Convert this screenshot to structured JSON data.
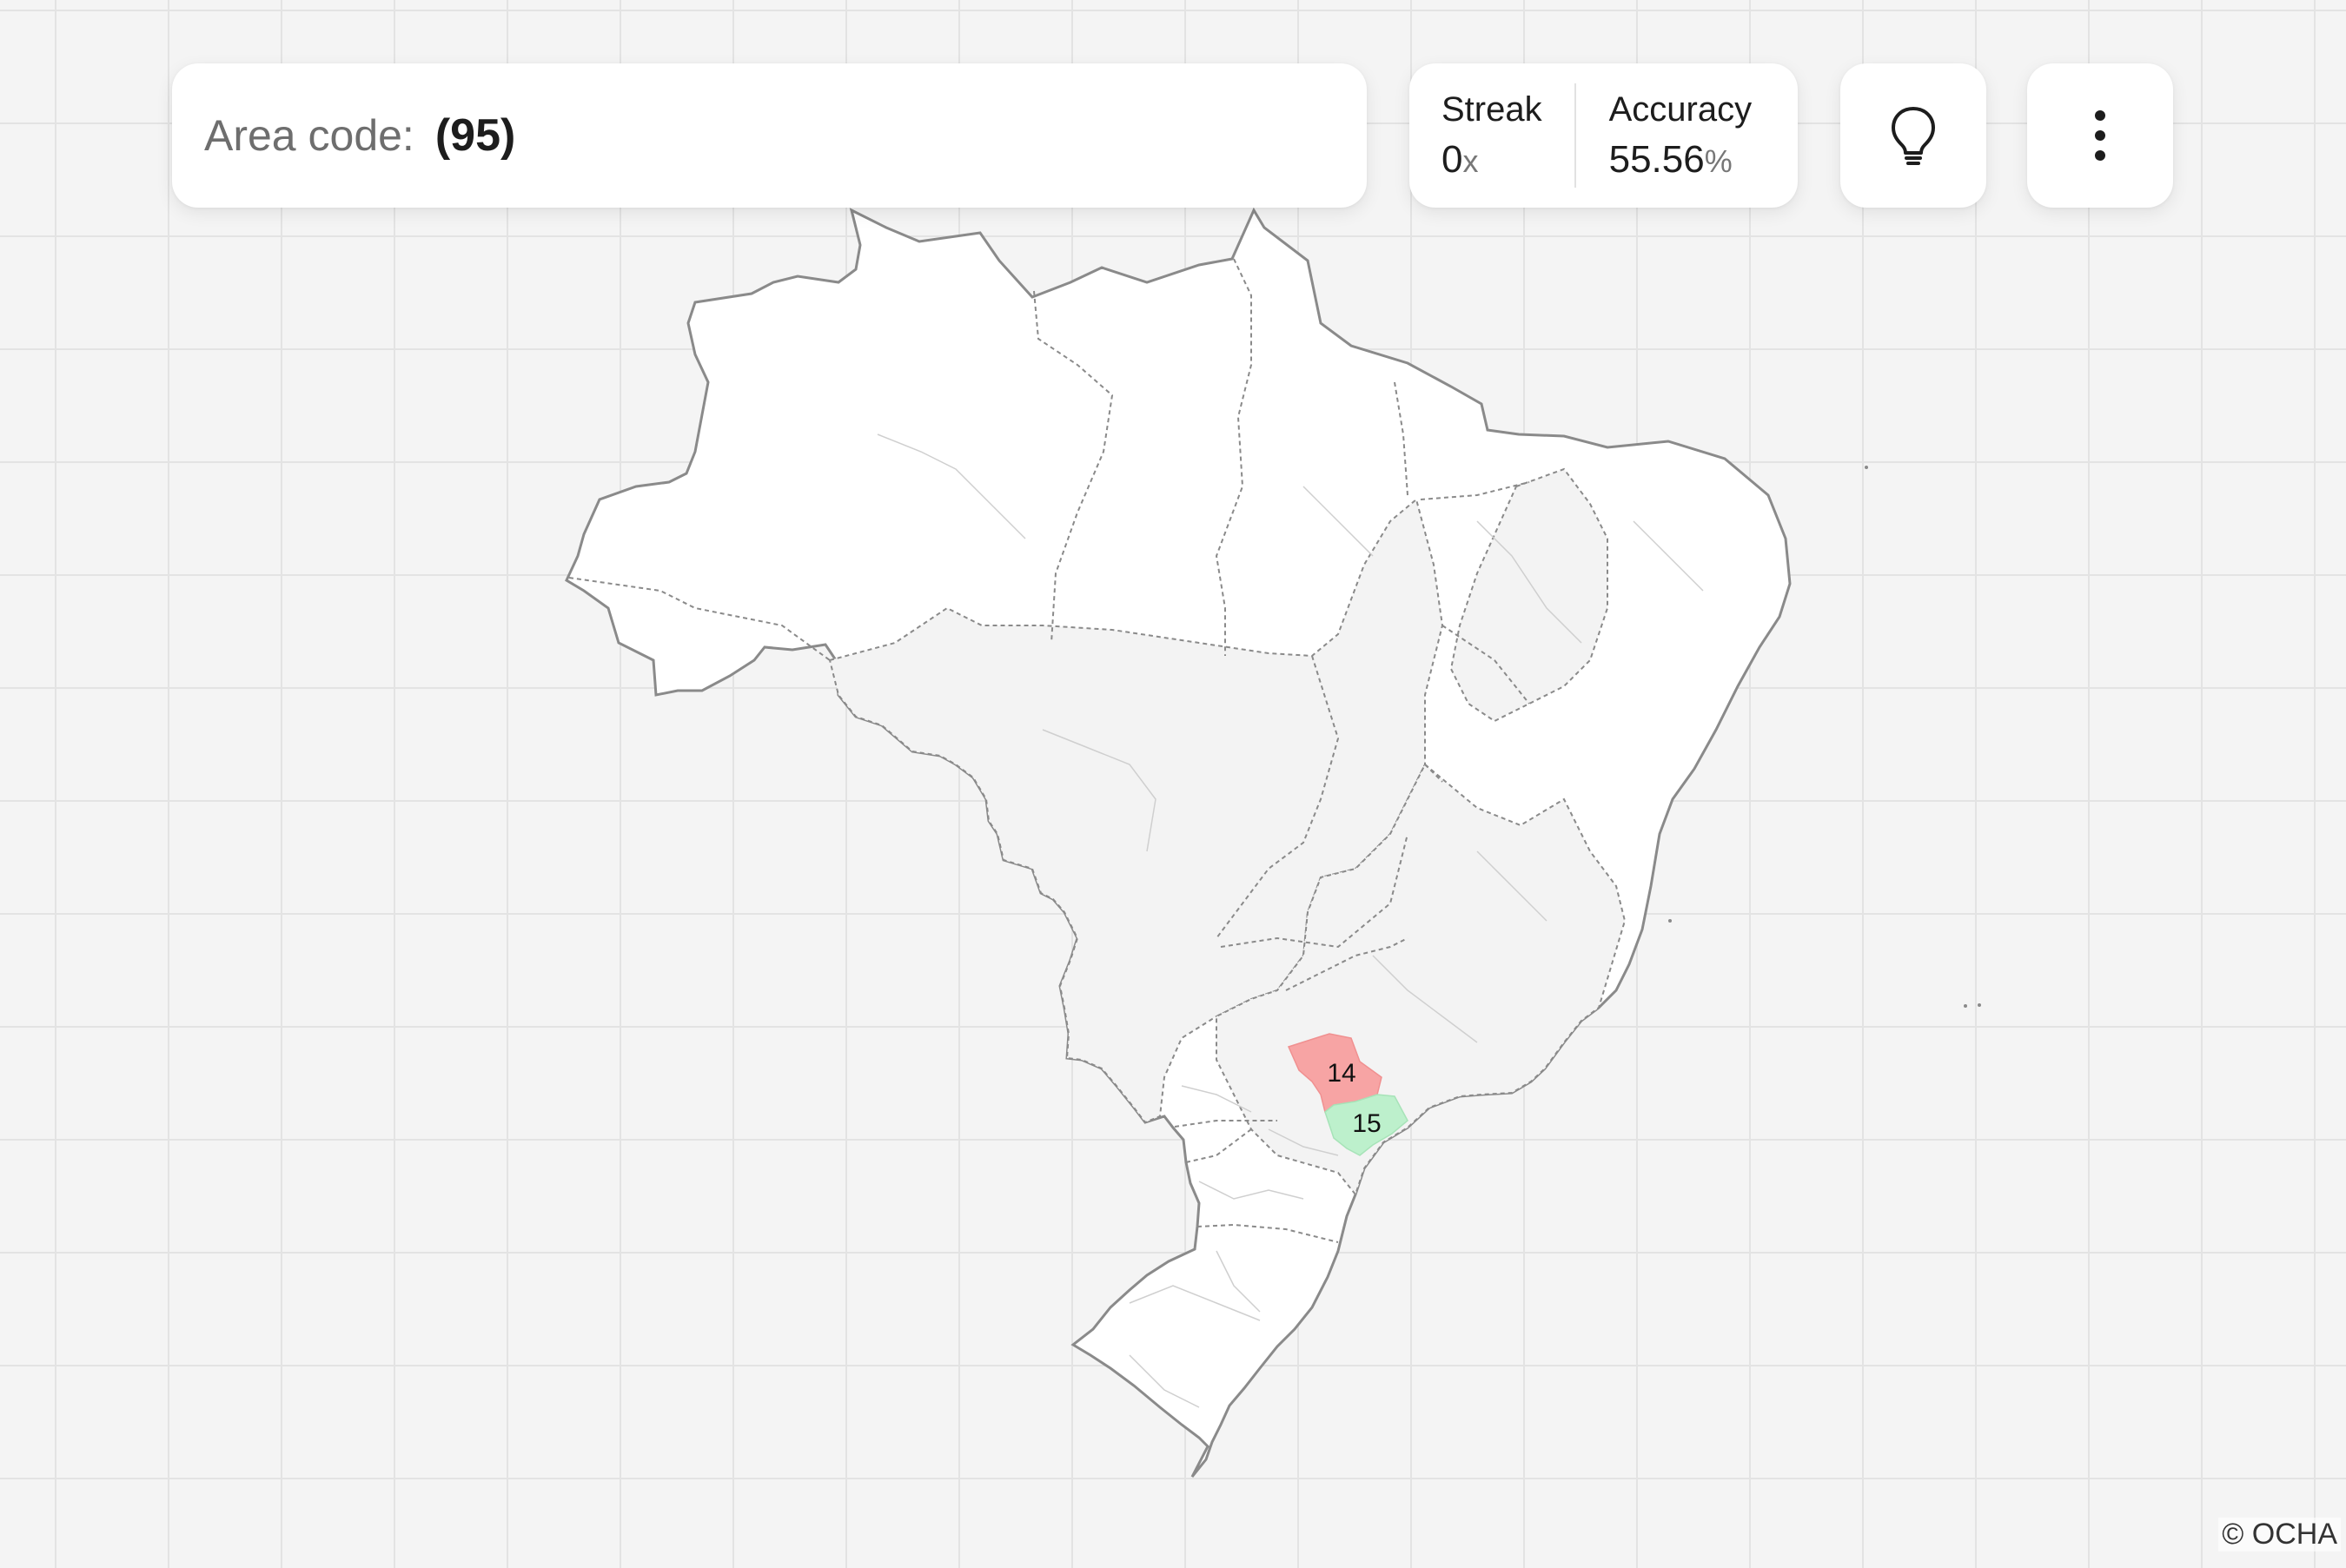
{
  "prompt": {
    "label": "Area code:",
    "value": "(95)"
  },
  "stats": {
    "streak_label": "Streak",
    "streak_value": "0",
    "streak_unit": "x",
    "accuracy_label": "Accuracy",
    "accuracy_value": "55.56",
    "accuracy_unit": "%"
  },
  "buttons": {
    "hint_icon": "lightbulb-icon",
    "menu_icon": "more-vertical-icon"
  },
  "map": {
    "country": "Brazil",
    "highlights": [
      {
        "label": "14",
        "status": "incorrect",
        "color": "#f7a4a4"
      },
      {
        "label": "15",
        "status": "correct",
        "color": "#bdf0cc"
      }
    ],
    "colors": {
      "background": "#f4f4f4",
      "land": "#ffffff",
      "land_shaded": "#f3f3f3",
      "border": "#8a8a8a"
    }
  },
  "credit": "© OCHA"
}
